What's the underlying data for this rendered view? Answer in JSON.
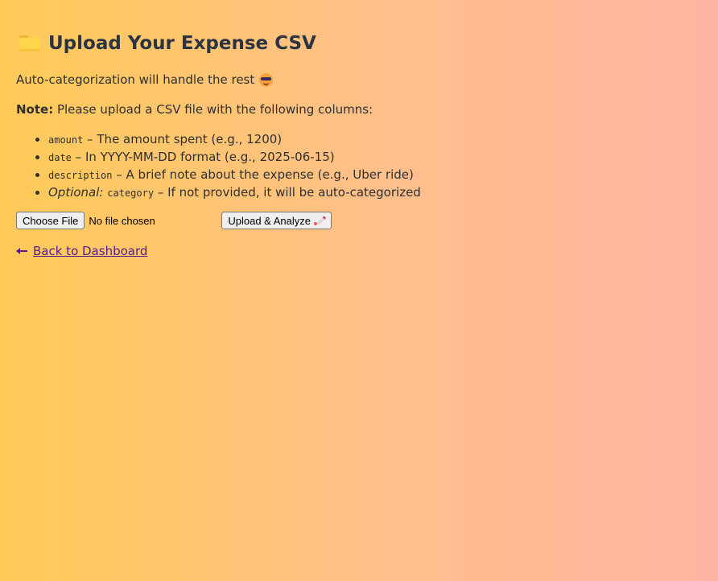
{
  "header": {
    "icon": "folder-icon",
    "title": "Upload Your Expense CSV"
  },
  "subtitle": {
    "text": "Auto-categorization will handle the rest",
    "icon": "sunglasses-face-icon"
  },
  "note": {
    "label": "Note:",
    "text": " Please upload a CSV file with the following columns:"
  },
  "columns": [
    {
      "prefix": "",
      "code": "amount",
      "description": " – The amount spent (e.g., 1200)"
    },
    {
      "prefix": "",
      "code": "date",
      "description": " – In YYYY-MM-DD format (e.g., 2025-06-15)"
    },
    {
      "prefix": "",
      "code": "description",
      "description": " – A brief note about the expense (e.g., Uber ride)"
    },
    {
      "prefix": "Optional:",
      "code": "category",
      "description": " – If not provided, it will be auto-categorized"
    }
  ],
  "form": {
    "choose_file_label": "Choose File",
    "file_status": "No file chosen",
    "submit_label": "Upload & Analyze",
    "submit_icon": "rocket-icon"
  },
  "back_link": {
    "icon": "left-arrow-icon",
    "label": "Back to Dashboard"
  },
  "colors": {
    "gradient_start": "#ffcb57",
    "gradient_end": "#ffb4a2",
    "heading": "#2b3440",
    "link": "#551a8b"
  }
}
